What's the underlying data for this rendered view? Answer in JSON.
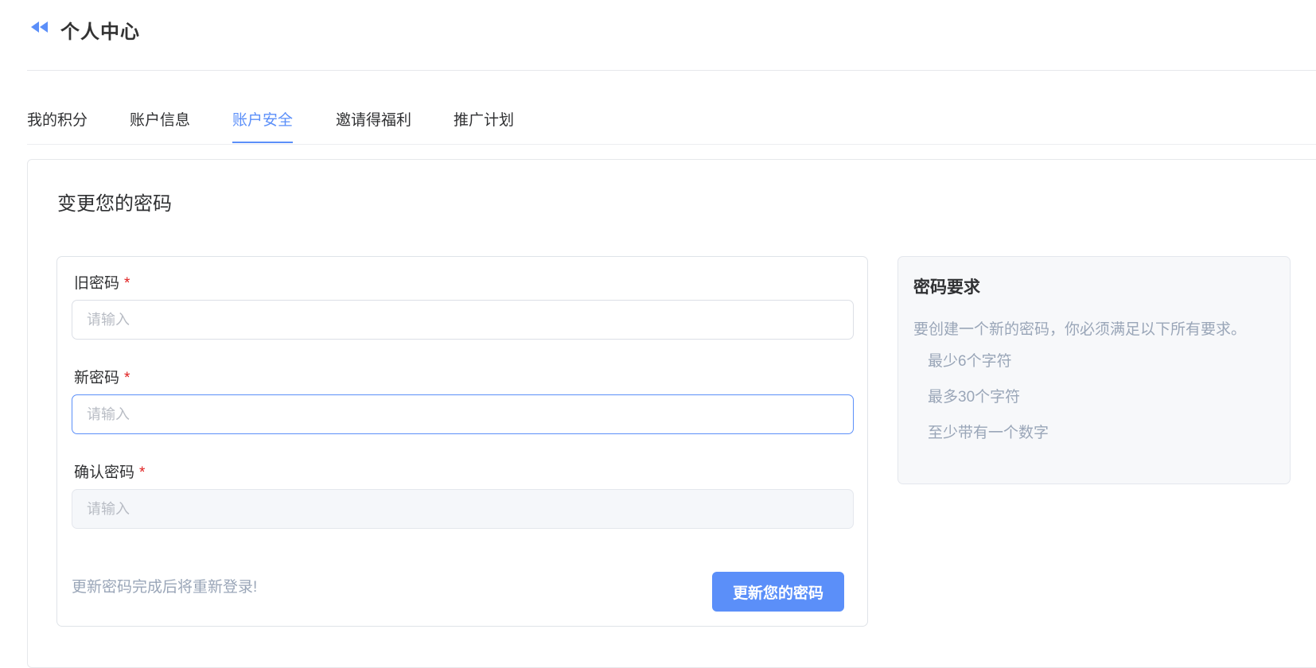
{
  "header": {
    "title": "个人中心",
    "back_icon": "double-chevron-left-icon",
    "accent": "#5b8ff9"
  },
  "tabs": [
    {
      "label": "我的积分",
      "active": false
    },
    {
      "label": "账户信息",
      "active": false
    },
    {
      "label": "账户安全",
      "active": true
    },
    {
      "label": "邀请得福利",
      "active": false
    },
    {
      "label": "推广计划",
      "active": false
    }
  ],
  "card": {
    "title": "变更您的密码",
    "form": {
      "old_password": {
        "label": "旧密码",
        "required_mark": "*",
        "placeholder": "请输入",
        "value": ""
      },
      "new_password": {
        "label": "新密码",
        "required_mark": "*",
        "placeholder": "请输入",
        "value": ""
      },
      "confirm_password": {
        "label": "确认密码",
        "required_mark": "*",
        "placeholder": "请输入",
        "value": ""
      },
      "note": "更新密码完成后将重新登录!",
      "submit_label": "更新您的密码"
    },
    "requirements": {
      "title": "密码要求",
      "description": "要创建一个新的密码，你必须满足以下所有要求。",
      "items": [
        "最少6个字符",
        "最多30个字符",
        "至少带有一个数字"
      ]
    }
  }
}
